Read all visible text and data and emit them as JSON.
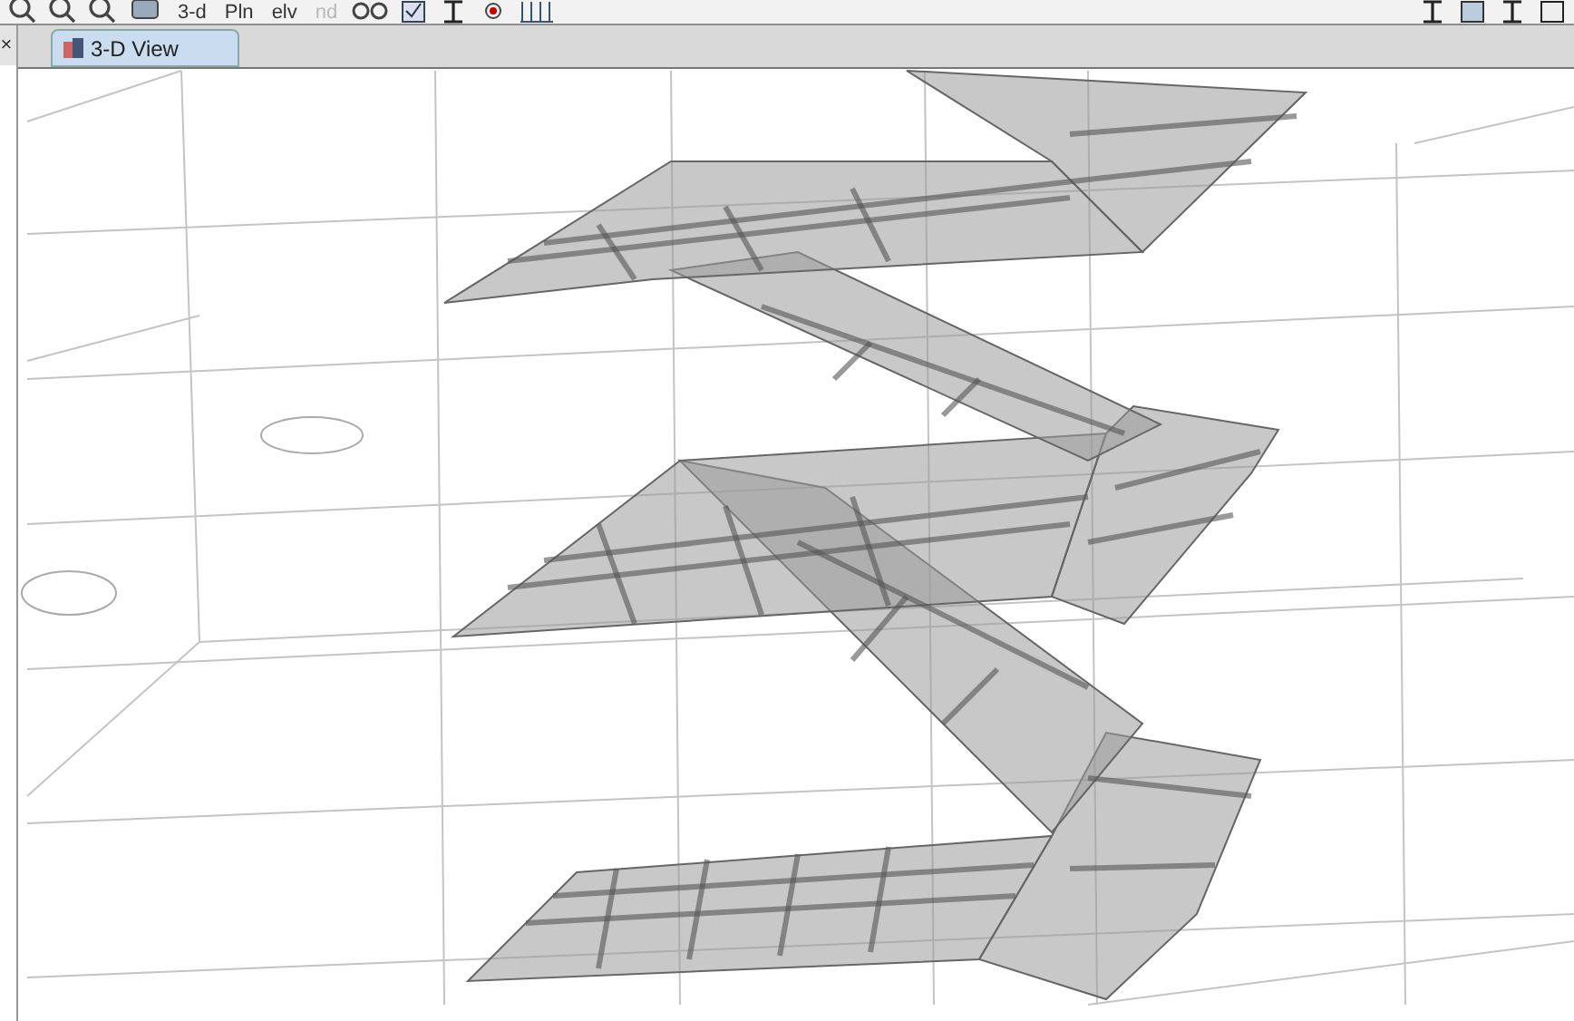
{
  "toolbar": {
    "buttons": [
      {
        "label": "3-d",
        "disabled": false
      },
      {
        "label": "Pln",
        "disabled": false
      },
      {
        "label": "elv",
        "disabled": false
      },
      {
        "label": "nd",
        "disabled": true
      }
    ]
  },
  "left_panel": {
    "close": "×"
  },
  "tabs": [
    {
      "label": "3-D View",
      "selected": true
    }
  ]
}
